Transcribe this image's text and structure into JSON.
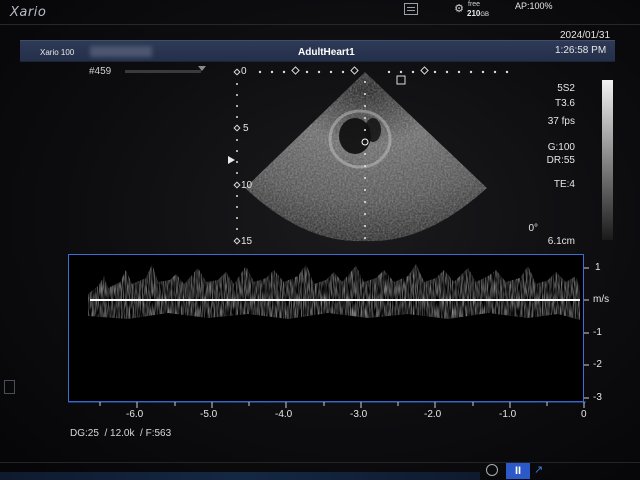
{
  "top_bar": {
    "brand": "Xario",
    "free_label": "free",
    "free_value": "210",
    "free_unit": "GB",
    "ap_label": "AP:100%"
  },
  "header": {
    "probe_id": "Xario 100",
    "exam_title": "AdultHeart1",
    "date": "2024/01/31",
    "time": "1:26:58 PM"
  },
  "frame": {
    "label": "#459"
  },
  "params": {
    "probe": "5S2",
    "freq": "T3.6",
    "fps": "37 fps",
    "gain": "G:100",
    "dr": "DR:55",
    "te": "TE:4",
    "angle": "0°",
    "depth": "6.1cm"
  },
  "depth_scale": [
    "0",
    "5",
    "10",
    "15"
  ],
  "doppler": {
    "y_ticks": [
      "1",
      "0",
      "-1",
      "-2",
      "-3"
    ],
    "y_unit": "m/s",
    "x_ticks": [
      "-6.0",
      "-5.0",
      "-4.0",
      "-3.0",
      "-2.0",
      "-1.0",
      "0"
    ]
  },
  "footer": {
    "info": "DG:25  / 12.0k  / F:563"
  },
  "bottom_bar": {
    "cine_label": "II"
  },
  "colors": {
    "accent": "#3a6fd8",
    "button": "#2b59c7",
    "header_band": "#2a3652"
  }
}
